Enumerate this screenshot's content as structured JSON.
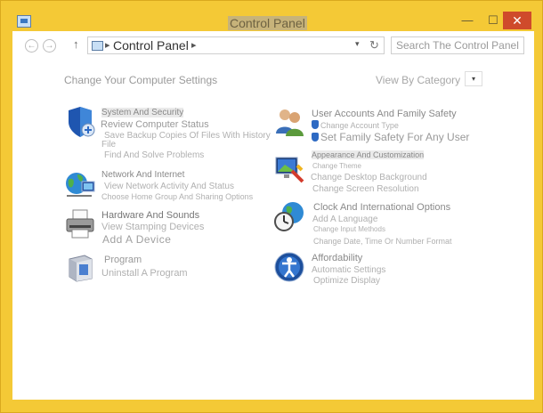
{
  "window": {
    "title": "Control Panel",
    "minimize_glyph": "—",
    "maximize_glyph": "☐",
    "close_glyph": "✕"
  },
  "nav": {
    "back_glyph": "←",
    "forward_glyph": "→",
    "up_glyph": "↑",
    "address_sep_glyph": "▸",
    "address": "Control Panel",
    "address_after_glyph": "▸",
    "dropdown_glyph": "▾",
    "refresh_glyph": "↻",
    "search_placeholder": "Search The Control Panel"
  },
  "main": {
    "heading": "Change Your Computer Settings",
    "view_by": "View By Category",
    "view_by_glyph": "▾"
  },
  "categories": [
    {
      "id": "system",
      "icon": "shield-icon",
      "title": "System And Security",
      "links": [
        "Review Computer Status",
        "Save Backup Copies Of Files With History",
        "File",
        "Find And Solve Problems"
      ]
    },
    {
      "id": "network",
      "icon": "network-globe-icon",
      "title": "Network And Internet",
      "links": [
        "View Network Activity And Status",
        "Choose Home Group And Sharing Options"
      ]
    },
    {
      "id": "hardware",
      "icon": "printer-icon",
      "title": "Hardware And Sounds",
      "links": [
        "View Stamping Devices",
        "Add A Device"
      ]
    },
    {
      "id": "programs",
      "icon": "programs-box-icon",
      "title": "Program",
      "links": [
        "Uninstall A Program"
      ]
    },
    {
      "id": "users",
      "icon": "users-icon",
      "title": "User Accounts And Family Safety",
      "links": [
        "Change Account Type",
        "Set Family Safety For Any User"
      ]
    },
    {
      "id": "appearance",
      "icon": "display-icon",
      "title": "Appearance And Customization",
      "links": [
        "Change Theme",
        "Change Desktop Background",
        "Change Screen Resolution"
      ]
    },
    {
      "id": "clock",
      "icon": "clock-globe-icon",
      "title": "Clock And International Options",
      "links": [
        "Add A Language",
        "Change Input Methods",
        "Change Date, Time Or Number Format"
      ]
    },
    {
      "id": "accessibility",
      "icon": "accessibility-icon",
      "title": "Affordability",
      "links": [
        "Automatic Settings",
        "Optimize Display"
      ]
    }
  ]
}
